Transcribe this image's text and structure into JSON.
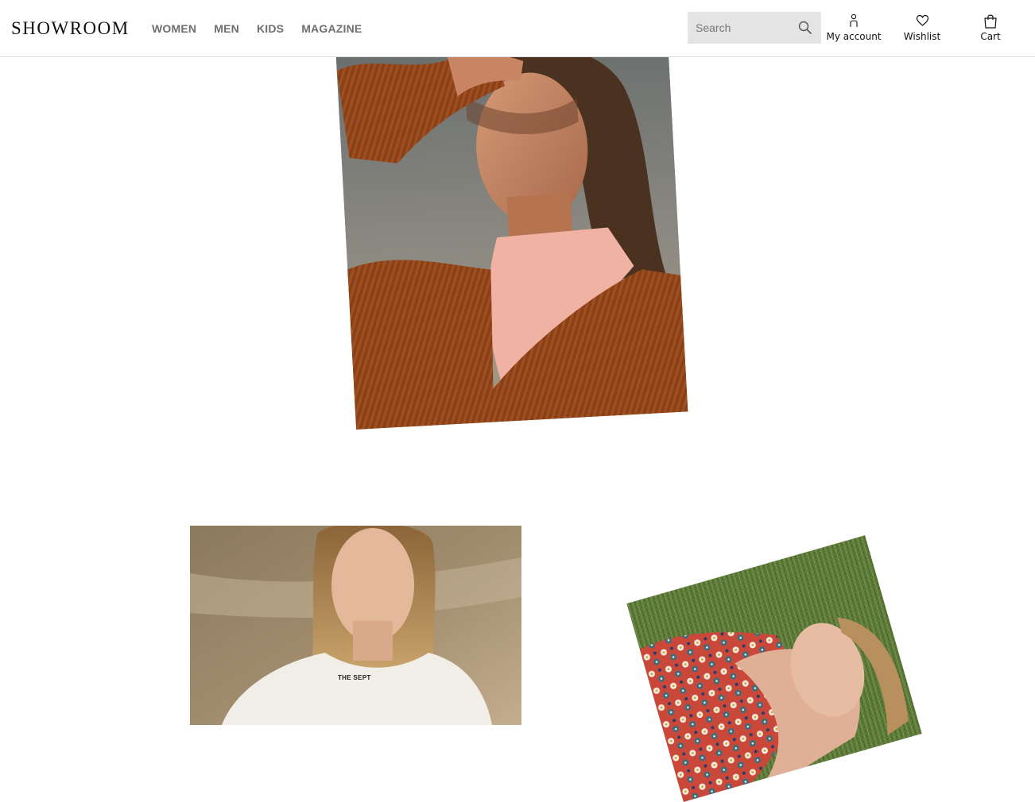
{
  "header": {
    "logo": "SHOWROOM",
    "nav": [
      {
        "label": "WOMEN"
      },
      {
        "label": "MEN"
      },
      {
        "label": "KIDS"
      },
      {
        "label": "MAGAZINE"
      }
    ],
    "search": {
      "placeholder": "Search",
      "value": ""
    },
    "actions": {
      "account": "My account",
      "wishlist": "Wishlist",
      "cart": "Cart"
    }
  },
  "photos": [
    {
      "subject": "woman-in-rust-knit-sweater"
    },
    {
      "subject": "woman-in-white-sweatshirt",
      "shirt_print": "THE SEPT"
    },
    {
      "subject": "woman-in-floral-shirt-lying-on-grass"
    }
  ],
  "colors": {
    "nav_text": "#6e6e6e",
    "search_bg": "#e4e4e4",
    "divider": "#dcdcdc"
  }
}
